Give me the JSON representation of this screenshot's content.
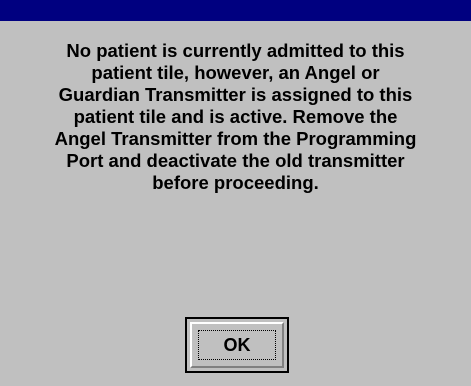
{
  "dialog": {
    "message_lines": [
      "No patient is currently admitted to this",
      "patient tile, however, an Angel or",
      "Guardian Transmitter is assigned to this",
      "patient tile and is active. Remove the",
      "Angel Transmitter from the Programming",
      "Port and deactivate the old transmitter",
      "before proceeding."
    ],
    "ok_label": "OK"
  },
  "colors": {
    "titlebar": "#000080",
    "background": "#c0c0c0"
  }
}
